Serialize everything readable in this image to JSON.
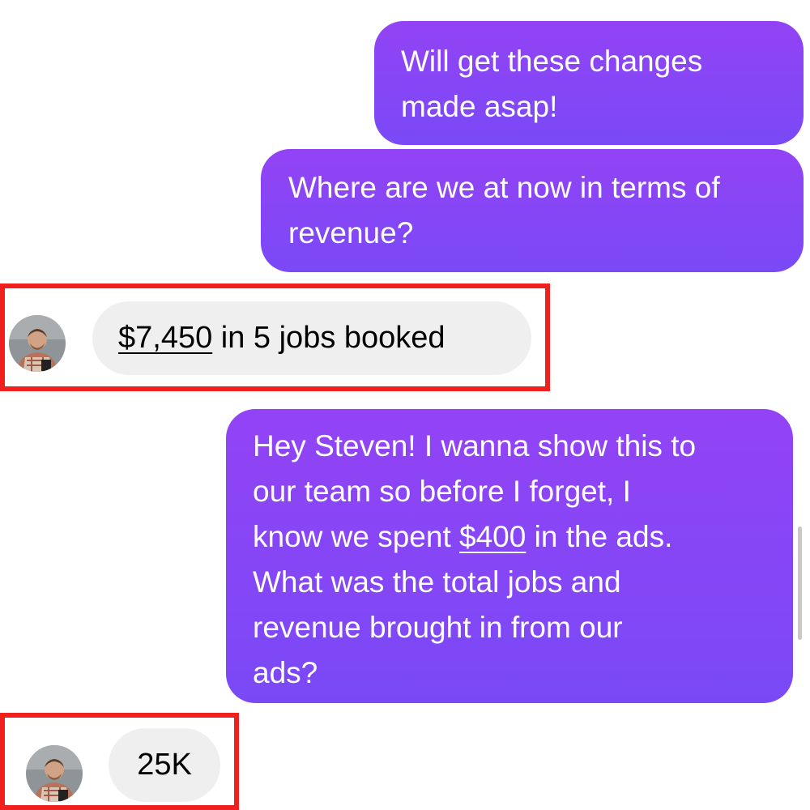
{
  "messages": {
    "m1": {
      "text": "Will get these changes made asap!"
    },
    "m2": {
      "text": "Where are we at now in terms of revenue?"
    },
    "m3": {
      "amount": "$7,450",
      "rest": " in 5 jobs booked"
    },
    "m4": {
      "line1": "Hey Steven! I wanna show this to",
      "line2": "our team so before I forget, I",
      "line3_pre": "know we spent ",
      "line3_amount": "$400",
      "line3_post": " in the ads.",
      "line4": "What was the total jobs and",
      "line5": "revenue brought in from our",
      "line6": "ads?"
    },
    "m5": {
      "text": "25K"
    }
  },
  "colors": {
    "outgoing_bubble_top": "#9243f5",
    "outgoing_bubble_bottom": "#7a49f6",
    "incoming_bubble": "#efefef",
    "highlight": "#f0201f"
  },
  "icons": {
    "avatar": "person-avatar-icon"
  }
}
